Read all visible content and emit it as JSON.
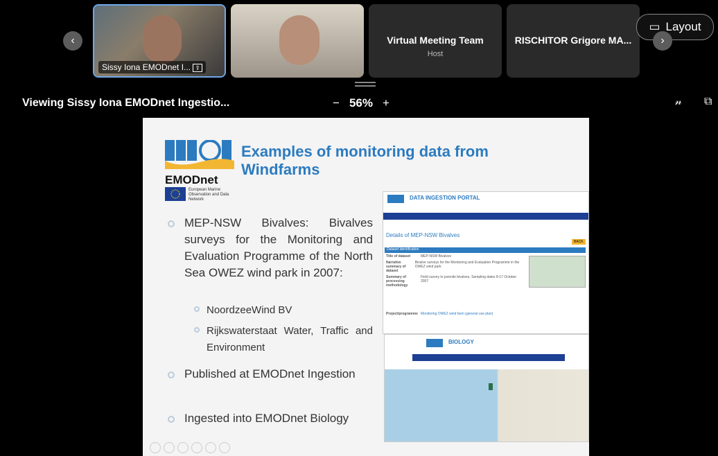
{
  "top_strip": {
    "prev_icon": "chevron-left-icon",
    "next_icon": "chevron-right-icon",
    "participants": [
      {
        "name": "Sissy Iona EMODnet I...",
        "active": true
      },
      {
        "name": "",
        "active": false
      },
      {
        "name": "Virtual Meeting Team",
        "role": "Host"
      },
      {
        "name": "RISCHITOR Grigore MA..."
      }
    ],
    "layout_label": "Layout",
    "layout_icon": "layout-icon"
  },
  "view_bar": {
    "title": "Viewing Sissy Iona EMODnet Ingestio...",
    "zoom_minus": "−",
    "zoom": "56%",
    "zoom_plus": "+"
  },
  "slide": {
    "title": "Examples of monitoring data from Windfarms",
    "logo_text": "EMODnet",
    "logo_sub": "European Marine Observation and Data Network",
    "bullet1": "MEP-NSW Bivalves: Bivalves surveys for the Monitoring and Evaluation Programme of the North Sea OWEZ wind park in 2007:",
    "sub1": "NoordzeeWind BV",
    "sub2": "Rijkswaterstaat Water, Traffic and Environment",
    "bullet2": "Published at EMODnet Ingestion",
    "bullet3": "Ingested into EMODnet Biology",
    "shot1": {
      "portal": "DATA INGESTION PORTAL",
      "heading": "Details of MEP-NSW Bivalves",
      "back": "BACK",
      "section": "Dataset identification",
      "rows": [
        {
          "k": "Title of dataset",
          "v": "MEP-NSW Bivalves"
        },
        {
          "k": "Narrative summary of dataset",
          "v": "Bivalve surveys for the Monitoring and Evaluation Programme in the OWEZ wind park"
        },
        {
          "k": "Summary of processing methodology",
          "v": "Field survey to juvenile bivalves, Sampling dates 8-17 October 2007"
        },
        {
          "k": "Project/programme",
          "v": "Monitoring OWEZ wind farm (general use plan)"
        }
      ]
    },
    "shot2": {
      "portal": "BIOLOGY"
    }
  },
  "colors": {
    "accent": "#2c7bc0",
    "strip_bg": "#000000",
    "tile_bg": "#2a2a2a"
  }
}
